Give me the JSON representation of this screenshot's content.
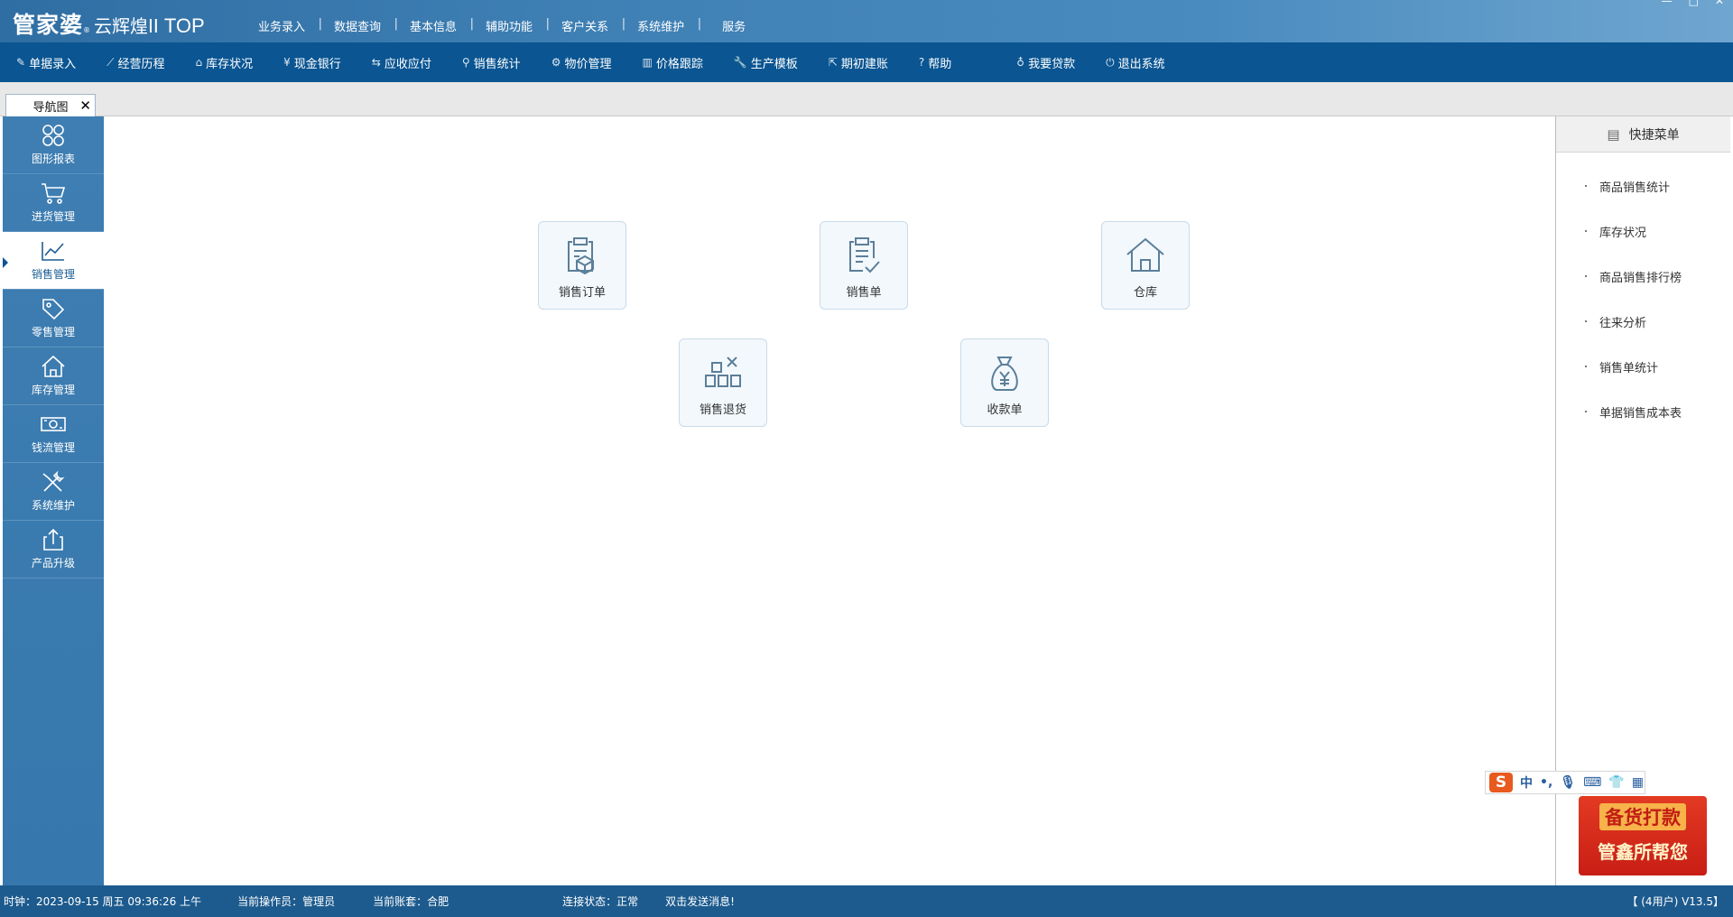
{
  "brand": {
    "main": "管家婆",
    "reg": "®",
    "sub": "云辉煌II",
    "top": "TOP"
  },
  "top_menu": [
    "业务录入",
    "数据查询",
    "基本信息",
    "辅助功能",
    "客户关系",
    "系统维护",
    "服务"
  ],
  "toolbar": [
    {
      "label": "单据录入",
      "icon": "edit-icon"
    },
    {
      "label": "经营历程",
      "icon": "line-chart-icon"
    },
    {
      "label": "库存状况",
      "icon": "home-icon"
    },
    {
      "label": "现金银行",
      "icon": "yen-icon"
    },
    {
      "label": "应收应付",
      "icon": "exchange-icon"
    },
    {
      "label": "销售统计",
      "icon": "search-icon"
    },
    {
      "label": "物价管理",
      "icon": "gear-icon"
    },
    {
      "label": "价格跟踪",
      "icon": "bar-chart-icon"
    },
    {
      "label": "生产模板",
      "icon": "wrench-icon"
    },
    {
      "label": "期初建账",
      "icon": "external-link-icon"
    },
    {
      "label": "帮助",
      "icon": "question-icon"
    },
    {
      "label": "我要贷款",
      "icon": "money-bag-icon"
    },
    {
      "label": "退出系统",
      "icon": "power-icon"
    }
  ],
  "tab": {
    "label": "导航图",
    "close": "✕"
  },
  "sidebar": [
    {
      "label": "图形报表",
      "icon": "grid-icon",
      "active": false
    },
    {
      "label": "进货管理",
      "icon": "cart-icon",
      "active": false
    },
    {
      "label": "销售管理",
      "icon": "trend-icon",
      "active": true
    },
    {
      "label": "零售管理",
      "icon": "tag-icon",
      "active": false
    },
    {
      "label": "库存管理",
      "icon": "house-icon",
      "active": false
    },
    {
      "label": "钱流管理",
      "icon": "cash-icon",
      "active": false
    },
    {
      "label": "系统维护",
      "icon": "tools-icon",
      "active": false
    },
    {
      "label": "产品升级",
      "icon": "upload-icon",
      "active": false
    }
  ],
  "tiles": [
    {
      "label": "销售订单",
      "icon": "order-icon"
    },
    {
      "label": "销售单",
      "icon": "sales-doc-icon"
    },
    {
      "label": "仓库",
      "icon": "warehouse-icon"
    },
    {
      "label": "销售退货",
      "icon": "return-icon"
    },
    {
      "label": "收款单",
      "icon": "money-bag-icon"
    }
  ],
  "quick_menu": {
    "title": "快捷菜单",
    "items": [
      "商品销售统计",
      "库存状况",
      "商品销售排行榜",
      "往来分析",
      "销售单统计",
      "单据销售成本表"
    ]
  },
  "ime": {
    "logo": "S",
    "mode": "中",
    "punct": "•,",
    "icons": [
      "mic-icon",
      "keyboard-icon",
      "shirt-icon",
      "apps-icon"
    ]
  },
  "ad": {
    "line1": "备货打款",
    "line2": "管鑫所帮您"
  },
  "status": {
    "clock": "时钟：2023-09-15 周五 09:36:26 上午",
    "operator": "当前操作员：管理员",
    "account": "当前账套：合肥",
    "connection": "连接状态：正常",
    "message": "双击发送消息!",
    "version": "【 (4用户) V13.5】"
  },
  "colors": {
    "toolbar": "#0a5592",
    "sidebar": "#3f7eb2",
    "status": "#1d5b8e",
    "accent": "#1d5e93"
  }
}
